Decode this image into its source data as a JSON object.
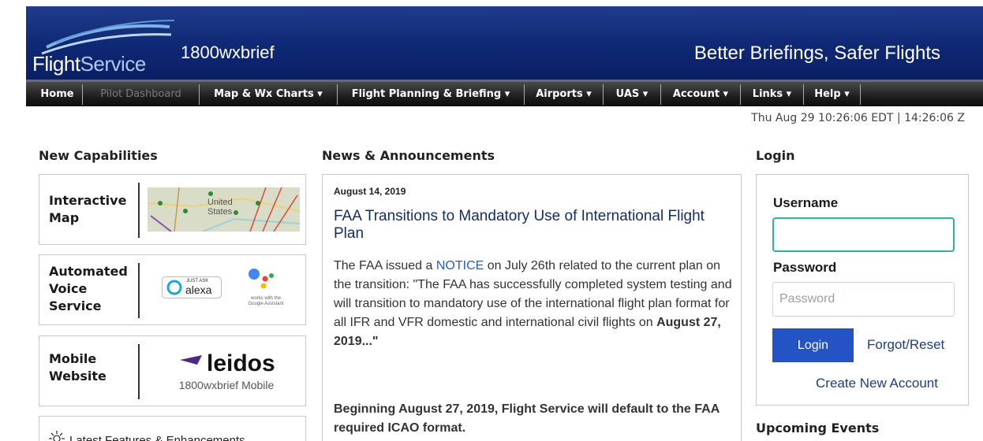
{
  "header": {
    "logo_primary": "Flight",
    "logo_secondary": "Service",
    "site_id": "1800wxbrief",
    "tagline": "Better Briefings, Safer Flights"
  },
  "nav": {
    "items": [
      {
        "label": "Home",
        "disabled": false
      },
      {
        "label": "Pilot Dashboard",
        "disabled": true
      },
      {
        "label": "Map & Wx Charts ▾",
        "disabled": false
      },
      {
        "label": "Flight Planning & Briefing ▾",
        "disabled": false
      },
      {
        "label": "Airports ▾",
        "disabled": false
      },
      {
        "label": "UAS ▾",
        "disabled": false
      },
      {
        "label": "Account ▾",
        "disabled": false
      },
      {
        "label": "Links ▾",
        "disabled": false
      },
      {
        "label": "Help ▾",
        "disabled": false
      }
    ]
  },
  "clock": "Thu Aug 29 10:26:06 EDT | 14:26:06 Z",
  "capabilities": {
    "title": "New Capabilities",
    "cards": [
      {
        "label_lines": [
          "Interactive",
          "Map"
        ],
        "map_text": [
          "United",
          "States"
        ]
      },
      {
        "label_lines": [
          "Automated",
          "Voice",
          "Service"
        ],
        "alexa_small": "JUST ASK",
        "alexa": "alexa",
        "google_small": [
          "works with the",
          "Google Assistant"
        ]
      },
      {
        "label_lines": [
          "Mobile",
          "Website"
        ],
        "leidos": "leidos",
        "leidos_sub": "1800wxbrief Mobile"
      }
    ],
    "latest_label": "Latest Features & Enhancements"
  },
  "news": {
    "title": "News & Announcements",
    "date": "August 14, 2019",
    "headline": "FAA Transitions to Mandatory Use of International Flight Plan",
    "body_pre": "The FAA issued a ",
    "body_link": "NOTICE",
    "body_post": " on July 26th related to the current plan on the transition: \"The FAA has successfully completed system testing and will transition to mandatory use of the international flight plan format for all IFR and VFR domestic and international civil flights on ",
    "body_bold": "August 27, 2019...\"",
    "note": "Beginning August 27, 2019, Flight Service will default to the FAA required ICAO format."
  },
  "login": {
    "title": "Login",
    "username_label": "Username",
    "username_value": "",
    "password_label": "Password",
    "password_placeholder": "Password",
    "login_button": "Login",
    "forgot": "Forgot/Reset",
    "create": "Create New Account"
  },
  "events": {
    "title": "Upcoming Events"
  },
  "colors": {
    "header_blue": "#0f2874",
    "nav_black": "#1e1e1e",
    "login_button": "#2353c4",
    "input_focus": "#2bb59a",
    "link": "#1e3e7e"
  }
}
